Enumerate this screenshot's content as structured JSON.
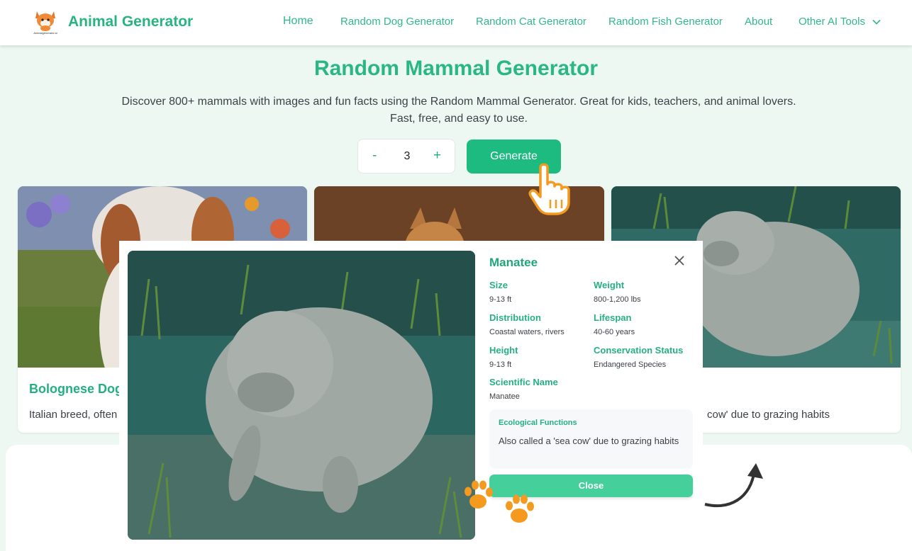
{
  "header": {
    "logo_icon": "fox-logo-icon",
    "logo_caption": "Animalgenerator.ai",
    "brand": "Animal Generator",
    "nav": {
      "home": "Home",
      "dog": "Random Dog Generator",
      "cat": "Random Cat Generator",
      "fish": "Random Fish Generator",
      "about": "About",
      "tools": "Other AI Tools"
    }
  },
  "hero": {
    "title": "Random Mammal Generator",
    "description": "Discover 800+ mammals with images and fun facts using the Random Mammal Generator. Great for kids, teachers, and animal lovers. Fast, free, and easy to use."
  },
  "controls": {
    "minus": "-",
    "count": "3",
    "plus": "+",
    "generate": "Generate"
  },
  "cards": [
    {
      "title": "Bolognese Dog",
      "desc": "Italian breed, often",
      "image_icon": "bolognese-dog-photo"
    },
    {
      "title": "",
      "desc": "",
      "image_icon": "fox-photo"
    },
    {
      "title": "",
      "desc": "cow' due to grazing habits",
      "image_icon": "manatee-photo"
    }
  ],
  "modal": {
    "title": "Manatee",
    "image_icon": "manatee-photo",
    "facts": {
      "size_label": "Size",
      "size": "9-13 ft",
      "weight_label": "Weight",
      "weight": "800-1,200 lbs",
      "distribution_label": "Distribution",
      "distribution": "Coastal waters, rivers",
      "lifespan_label": "Lifespan",
      "lifespan": "40-60 years",
      "height_label": "Height",
      "height": "9-13 ft",
      "conservation_label": "Conservation Status",
      "conservation": "Endangered Species",
      "scientific_label": "Scientific Name",
      "scientific": "Manatee"
    },
    "eco_label": "Ecological Functions",
    "eco_text": "Also called a 'sea cow' due to grazing habits",
    "close": "Close"
  },
  "colors": {
    "accent": "#1dbb80",
    "accent_light": "#45cf9b",
    "page_bg": "#eef8f3",
    "paw": "#f39a1f"
  }
}
